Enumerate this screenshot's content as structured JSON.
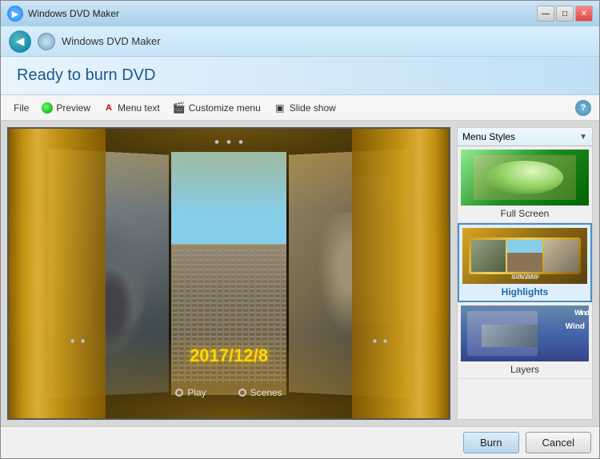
{
  "window": {
    "title": "Windows DVD Maker",
    "title_icon": "dvd",
    "controls": {
      "minimize": "—",
      "maximize": "□",
      "close": "✕"
    }
  },
  "nav": {
    "back_label": "◀",
    "app_title": "Windows DVD Maker"
  },
  "header": {
    "title": "Ready to burn DVD"
  },
  "toolbar": {
    "file_label": "File",
    "preview_label": "Preview",
    "menu_text_label": "Menu text",
    "customize_menu_label": "Customize menu",
    "slideshow_label": "Slide show",
    "help_label": "?"
  },
  "preview": {
    "date_text": "2017/12/8",
    "play_label": "Play",
    "scenes_label": "Scenes"
  },
  "styles_panel": {
    "dropdown_label": "Menu Styles",
    "items": [
      {
        "id": "full-screen",
        "label": "Full Screen",
        "selected": false
      },
      {
        "id": "highlights",
        "label": "Highlights",
        "selected": true
      },
      {
        "id": "layers",
        "label": "Layers",
        "selected": false
      }
    ]
  },
  "footer": {
    "burn_label": "Burn",
    "cancel_label": "Cancel"
  }
}
